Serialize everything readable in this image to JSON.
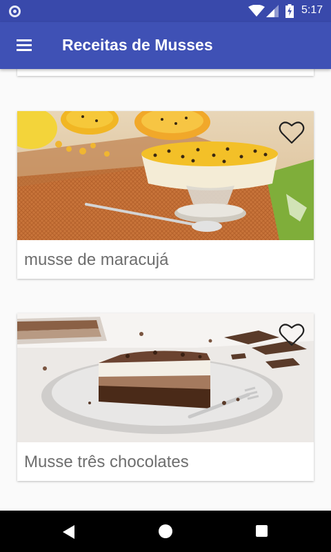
{
  "status_bar": {
    "time": "5:17"
  },
  "app_bar": {
    "title": "Receitas de Musses",
    "menu_icon": "menu-icon"
  },
  "recipes": [
    {
      "title": "musse de maracujá",
      "favorite_icon": "heart-outline-icon",
      "favorite": false
    },
    {
      "title": "Musse três chocolates",
      "favorite_icon": "heart-outline-icon",
      "favorite": false
    }
  ],
  "colors": {
    "status_bar": "#3949ab",
    "app_bar": "#3f51b5",
    "background": "#fafafa",
    "card_title_text": "#6e6e6e",
    "nav_bar": "#000000"
  },
  "nav_bar": {
    "back_icon": "back-triangle-icon",
    "home_icon": "home-circle-icon",
    "recents_icon": "recents-square-icon"
  }
}
